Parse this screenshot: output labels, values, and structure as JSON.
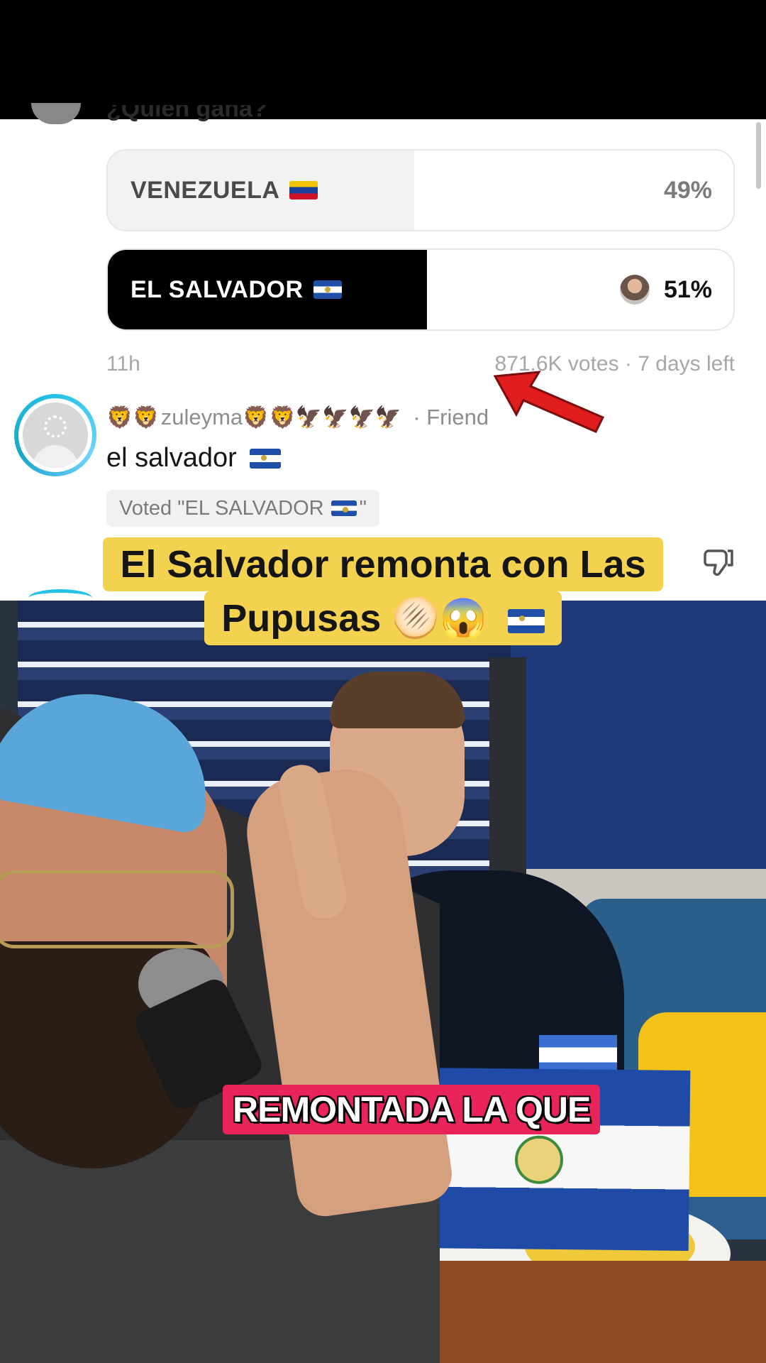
{
  "poll": {
    "question": "¿Quién gana?",
    "options": [
      {
        "label": "VENEZUELA",
        "percent_label": "49%",
        "percent": 49,
        "selected": false
      },
      {
        "label": "EL SALVADOR",
        "percent_label": "51%",
        "percent": 51,
        "selected": true
      }
    ],
    "age": "11h",
    "stats": "871.6K votes · 7 days left"
  },
  "comment": {
    "username": "zuleyma",
    "username_prefix": "🦁🦁",
    "username_suffix": "🦁🦁🦅🦅🦅🦅",
    "relation": "· Friend",
    "text": "el salvador",
    "voted_badge_prefix": "Voted \"EL SALVADOR",
    "voted_badge_suffix": "\""
  },
  "overlay": {
    "caption_line1": "El Salvador remonta con Las",
    "caption_line2": "Pupusas",
    "caption_emoji": "🫓😱",
    "subtitle": "REMONTADA LA QUE"
  },
  "colors": {
    "selected_fill": "#000000",
    "unselected_fill": "#f2f2f2",
    "caption_bg": "#f3d250",
    "subtitle_bg": "#e8245a",
    "arrow": "#e01c1c"
  },
  "icons": [
    "red-arrow-icon",
    "dislike-icon",
    "el-salvador-flag-icon",
    "venezuela-flag-icon"
  ]
}
